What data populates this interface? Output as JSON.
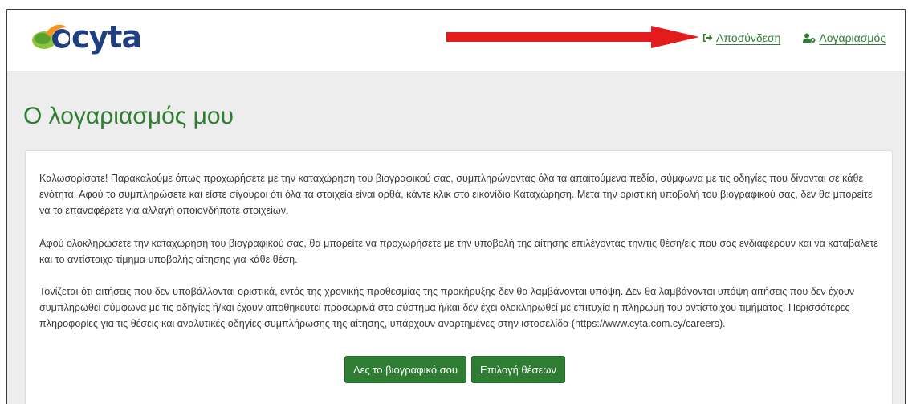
{
  "header": {
    "logo_text": "cyta",
    "logout_label": "Αποσύνδεση",
    "account_label": "Λογαριασμός",
    "annotation_arrow_color": "#e41b1b",
    "brand_green": "#2e7d32"
  },
  "main": {
    "title": "Ο λογαριασμός μου",
    "paragraphs": [
      "Καλωσορίσατε! Παρακαλούμε όπως προχωρήσετε με την καταχώρηση του βιογραφικού σας, συμπληρώνοντας όλα τα απαιτούμενα πεδία, σύμφωνα με τις οδηγίες που δίνονται σε κάθε ενότητα. Αφού το συμπληρώσετε και είστε σίγουροι ότι όλα τα στοιχεία είναι ορθά, κάντε κλικ στο εικονίδιο Καταχώρηση. Μετά την οριστική υποβολή του βιογραφικού σας, δεν θα μπορείτε να το επαναφέρετε για αλλαγή οποιονδήποτε στοιχείων.",
      "Αφού ολοκληρώσετε την καταχώρηση του βιογραφικού σας, θα μπορείτε να προχωρήσετε με την υποβολή της αίτησης επιλέγοντας την/τις θέση/εις που σας ενδιαφέρουν και να καταβάλετε και το αντίστοιχο τίμημα υποβολής αίτησης για κάθε θέση.",
      "Τονίζεται ότι αιτήσεις που δεν υποβάλλονται οριστικά, εντός της χρονικής προθεσμίας της προκήρυξης δεν θα λαμβάνονται υπόψη. Δεν θα λαμβάνονται υπόψη αιτήσεις που δεν έχουν συμπληρωθεί σύμφωνα με τις οδηγίες ή/και έχουν αποθηκευτεί προσωρινά στο σύστημα ή/και δεν έχει ολοκληρωθεί με επιτυχία η πληρωμή του αντίστοιχου τιμήματος. Περισσότερες πληροφορίες για τις θέσεις και αναλυτικές οδηγίες συμπλήρωσης της αίτησης, υπάρχουν αναρτημένες στην ιστοσελίδα (https://www.cyta.com.cy/careers)."
    ],
    "buttons": {
      "view_cv": "Δες το βιογραφικό σου",
      "select_positions": "Επιλογή θέσεων"
    }
  }
}
